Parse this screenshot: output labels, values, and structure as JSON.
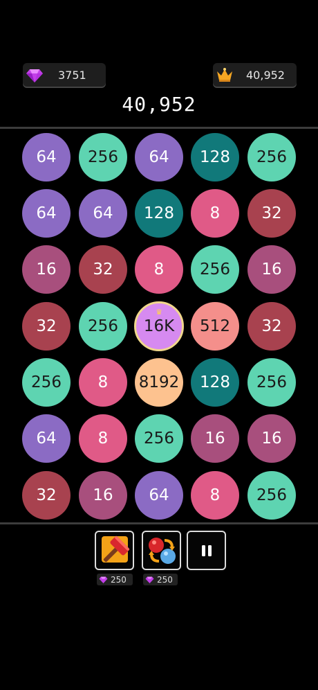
{
  "top_bar": {
    "gems": "3751",
    "best_score": "40,952"
  },
  "score": "40,952",
  "board": {
    "rows": [
      [
        {
          "v": "64",
          "c": "#8b6bc4"
        },
        {
          "v": "256",
          "c": "#5ed4b1"
        },
        {
          "v": "64",
          "c": "#8b6bc4"
        },
        {
          "v": "128",
          "c": "#11797a"
        },
        {
          "v": "256",
          "c": "#5ed4b1"
        }
      ],
      [
        {
          "v": "64",
          "c": "#8b6bc4"
        },
        {
          "v": "64",
          "c": "#8b6bc4"
        },
        {
          "v": "128",
          "c": "#11797a"
        },
        {
          "v": "8",
          "c": "#e05a87"
        },
        {
          "v": "32",
          "c": "#a8424f"
        }
      ],
      [
        {
          "v": "16",
          "c": "#a84f7d"
        },
        {
          "v": "32",
          "c": "#a8424f"
        },
        {
          "v": "8",
          "c": "#e05a87"
        },
        {
          "v": "256",
          "c": "#5ed4b1"
        },
        {
          "v": "16",
          "c": "#a84f7d"
        }
      ],
      [
        {
          "v": "32",
          "c": "#a8424f"
        },
        {
          "v": "256",
          "c": "#5ed4b1"
        },
        {
          "v": "16K",
          "c": "#d68af0",
          "special": true
        },
        {
          "v": "512",
          "c": "#f48f8b"
        },
        {
          "v": "32",
          "c": "#a8424f"
        }
      ],
      [
        {
          "v": "256",
          "c": "#5ed4b1"
        },
        {
          "v": "8",
          "c": "#e05a87"
        },
        {
          "v": "8192",
          "c": "#fdc28f"
        },
        {
          "v": "128",
          "c": "#11797a"
        },
        {
          "v": "256",
          "c": "#5ed4b1"
        }
      ],
      [
        {
          "v": "64",
          "c": "#8b6bc4"
        },
        {
          "v": "8",
          "c": "#e05a87"
        },
        {
          "v": "256",
          "c": "#5ed4b1"
        },
        {
          "v": "16",
          "c": "#a84f7d"
        },
        {
          "v": "16",
          "c": "#a84f7d"
        }
      ],
      [
        {
          "v": "32",
          "c": "#a8424f"
        },
        {
          "v": "16",
          "c": "#a84f7d"
        },
        {
          "v": "64",
          "c": "#8b6bc4"
        },
        {
          "v": "8",
          "c": "#e05a87"
        },
        {
          "v": "256",
          "c": "#5ed4b1"
        }
      ]
    ]
  },
  "tools": {
    "hammer": {
      "icon": "hammer-icon",
      "cost": "250"
    },
    "swap": {
      "icon": "swap-balls-icon",
      "cost": "250"
    },
    "pause": {
      "icon": "pause-icon"
    }
  },
  "colors": {
    "background": "#000000",
    "gem": "#c045ff",
    "crown": "#f5a623"
  }
}
